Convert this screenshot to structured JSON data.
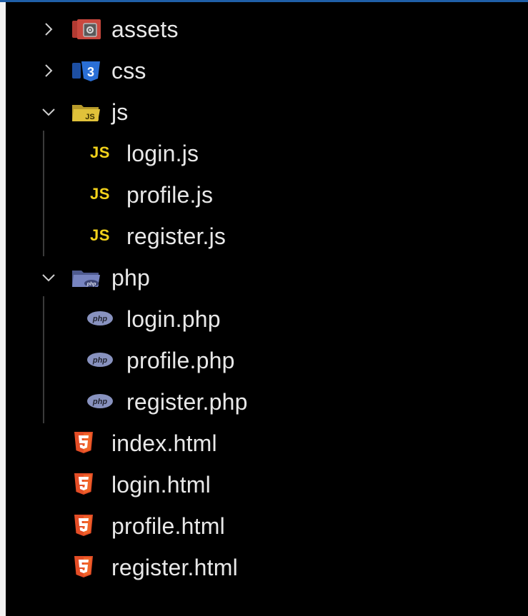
{
  "explorer": {
    "items": [
      {
        "label": "assets",
        "icon": "assets-folder-icon",
        "kind": "folder",
        "expanded": false
      },
      {
        "label": "css",
        "icon": "css-folder-icon",
        "kind": "folder",
        "expanded": false
      },
      {
        "label": "js",
        "icon": "js-folder-icon",
        "kind": "folder",
        "expanded": true
      },
      {
        "label": "login.js",
        "icon": "js-file-icon",
        "kind": "file",
        "badge": "JS"
      },
      {
        "label": "profile.js",
        "icon": "js-file-icon",
        "kind": "file",
        "badge": "JS"
      },
      {
        "label": "register.js",
        "icon": "js-file-icon",
        "kind": "file",
        "badge": "JS"
      },
      {
        "label": "php",
        "icon": "php-folder-icon",
        "kind": "folder",
        "expanded": true
      },
      {
        "label": "login.php",
        "icon": "php-file-icon",
        "kind": "file"
      },
      {
        "label": "profile.php",
        "icon": "php-file-icon",
        "kind": "file"
      },
      {
        "label": "register.php",
        "icon": "php-file-icon",
        "kind": "file"
      },
      {
        "label": "index.html",
        "icon": "html5-file-icon",
        "kind": "file"
      },
      {
        "label": "login.html",
        "icon": "html5-file-icon",
        "kind": "file"
      },
      {
        "label": "profile.html",
        "icon": "html5-file-icon",
        "kind": "file"
      },
      {
        "label": "register.html",
        "icon": "html5-file-icon",
        "kind": "file"
      }
    ]
  },
  "colors": {
    "background": "#000000",
    "text": "#e8e8e8",
    "js_badge": "#f2d21b",
    "html5": "#e44d26",
    "php": "#8892bf",
    "css": "#2a6fd6",
    "assets": "#b23a32"
  }
}
